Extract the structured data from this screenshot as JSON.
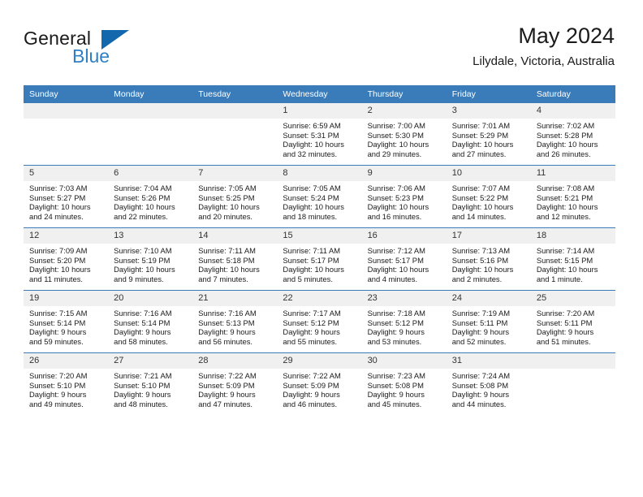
{
  "brand": {
    "word1": "General",
    "word2": "Blue",
    "triangle_color": "#1267ad",
    "blue_color": "#2f7fc4"
  },
  "header": {
    "title": "May 2024",
    "subtitle": "Lilydale, Victoria, Australia",
    "header_bg": "#3a7cba",
    "daynum_bg": "#f0f0f0"
  },
  "weekday_headers": [
    "Sunday",
    "Monday",
    "Tuesday",
    "Wednesday",
    "Thursday",
    "Friday",
    "Saturday"
  ],
  "weeks": [
    [
      {
        "day": "",
        "empty": true,
        "sunrise": "",
        "sunset": "",
        "daylight1": "",
        "daylight2": ""
      },
      {
        "day": "",
        "empty": true,
        "sunrise": "",
        "sunset": "",
        "daylight1": "",
        "daylight2": ""
      },
      {
        "day": "",
        "empty": true,
        "sunrise": "",
        "sunset": "",
        "daylight1": "",
        "daylight2": ""
      },
      {
        "day": "1",
        "empty": false,
        "sunrise": "Sunrise: 6:59 AM",
        "sunset": "Sunset: 5:31 PM",
        "daylight1": "Daylight: 10 hours",
        "daylight2": "and 32 minutes."
      },
      {
        "day": "2",
        "empty": false,
        "sunrise": "Sunrise: 7:00 AM",
        "sunset": "Sunset: 5:30 PM",
        "daylight1": "Daylight: 10 hours",
        "daylight2": "and 29 minutes."
      },
      {
        "day": "3",
        "empty": false,
        "sunrise": "Sunrise: 7:01 AM",
        "sunset": "Sunset: 5:29 PM",
        "daylight1": "Daylight: 10 hours",
        "daylight2": "and 27 minutes."
      },
      {
        "day": "4",
        "empty": false,
        "sunrise": "Sunrise: 7:02 AM",
        "sunset": "Sunset: 5:28 PM",
        "daylight1": "Daylight: 10 hours",
        "daylight2": "and 26 minutes."
      }
    ],
    [
      {
        "day": "5",
        "empty": false,
        "sunrise": "Sunrise: 7:03 AM",
        "sunset": "Sunset: 5:27 PM",
        "daylight1": "Daylight: 10 hours",
        "daylight2": "and 24 minutes."
      },
      {
        "day": "6",
        "empty": false,
        "sunrise": "Sunrise: 7:04 AM",
        "sunset": "Sunset: 5:26 PM",
        "daylight1": "Daylight: 10 hours",
        "daylight2": "and 22 minutes."
      },
      {
        "day": "7",
        "empty": false,
        "sunrise": "Sunrise: 7:05 AM",
        "sunset": "Sunset: 5:25 PM",
        "daylight1": "Daylight: 10 hours",
        "daylight2": "and 20 minutes."
      },
      {
        "day": "8",
        "empty": false,
        "sunrise": "Sunrise: 7:05 AM",
        "sunset": "Sunset: 5:24 PM",
        "daylight1": "Daylight: 10 hours",
        "daylight2": "and 18 minutes."
      },
      {
        "day": "9",
        "empty": false,
        "sunrise": "Sunrise: 7:06 AM",
        "sunset": "Sunset: 5:23 PM",
        "daylight1": "Daylight: 10 hours",
        "daylight2": "and 16 minutes."
      },
      {
        "day": "10",
        "empty": false,
        "sunrise": "Sunrise: 7:07 AM",
        "sunset": "Sunset: 5:22 PM",
        "daylight1": "Daylight: 10 hours",
        "daylight2": "and 14 minutes."
      },
      {
        "day": "11",
        "empty": false,
        "sunrise": "Sunrise: 7:08 AM",
        "sunset": "Sunset: 5:21 PM",
        "daylight1": "Daylight: 10 hours",
        "daylight2": "and 12 minutes."
      }
    ],
    [
      {
        "day": "12",
        "empty": false,
        "sunrise": "Sunrise: 7:09 AM",
        "sunset": "Sunset: 5:20 PM",
        "daylight1": "Daylight: 10 hours",
        "daylight2": "and 11 minutes."
      },
      {
        "day": "13",
        "empty": false,
        "sunrise": "Sunrise: 7:10 AM",
        "sunset": "Sunset: 5:19 PM",
        "daylight1": "Daylight: 10 hours",
        "daylight2": "and 9 minutes."
      },
      {
        "day": "14",
        "empty": false,
        "sunrise": "Sunrise: 7:11 AM",
        "sunset": "Sunset: 5:18 PM",
        "daylight1": "Daylight: 10 hours",
        "daylight2": "and 7 minutes."
      },
      {
        "day": "15",
        "empty": false,
        "sunrise": "Sunrise: 7:11 AM",
        "sunset": "Sunset: 5:17 PM",
        "daylight1": "Daylight: 10 hours",
        "daylight2": "and 5 minutes."
      },
      {
        "day": "16",
        "empty": false,
        "sunrise": "Sunrise: 7:12 AM",
        "sunset": "Sunset: 5:17 PM",
        "daylight1": "Daylight: 10 hours",
        "daylight2": "and 4 minutes."
      },
      {
        "day": "17",
        "empty": false,
        "sunrise": "Sunrise: 7:13 AM",
        "sunset": "Sunset: 5:16 PM",
        "daylight1": "Daylight: 10 hours",
        "daylight2": "and 2 minutes."
      },
      {
        "day": "18",
        "empty": false,
        "sunrise": "Sunrise: 7:14 AM",
        "sunset": "Sunset: 5:15 PM",
        "daylight1": "Daylight: 10 hours",
        "daylight2": "and 1 minute."
      }
    ],
    [
      {
        "day": "19",
        "empty": false,
        "sunrise": "Sunrise: 7:15 AM",
        "sunset": "Sunset: 5:14 PM",
        "daylight1": "Daylight: 9 hours",
        "daylight2": "and 59 minutes."
      },
      {
        "day": "20",
        "empty": false,
        "sunrise": "Sunrise: 7:16 AM",
        "sunset": "Sunset: 5:14 PM",
        "daylight1": "Daylight: 9 hours",
        "daylight2": "and 58 minutes."
      },
      {
        "day": "21",
        "empty": false,
        "sunrise": "Sunrise: 7:16 AM",
        "sunset": "Sunset: 5:13 PM",
        "daylight1": "Daylight: 9 hours",
        "daylight2": "and 56 minutes."
      },
      {
        "day": "22",
        "empty": false,
        "sunrise": "Sunrise: 7:17 AM",
        "sunset": "Sunset: 5:12 PM",
        "daylight1": "Daylight: 9 hours",
        "daylight2": "and 55 minutes."
      },
      {
        "day": "23",
        "empty": false,
        "sunrise": "Sunrise: 7:18 AM",
        "sunset": "Sunset: 5:12 PM",
        "daylight1": "Daylight: 9 hours",
        "daylight2": "and 53 minutes."
      },
      {
        "day": "24",
        "empty": false,
        "sunrise": "Sunrise: 7:19 AM",
        "sunset": "Sunset: 5:11 PM",
        "daylight1": "Daylight: 9 hours",
        "daylight2": "and 52 minutes."
      },
      {
        "day": "25",
        "empty": false,
        "sunrise": "Sunrise: 7:20 AM",
        "sunset": "Sunset: 5:11 PM",
        "daylight1": "Daylight: 9 hours",
        "daylight2": "and 51 minutes."
      }
    ],
    [
      {
        "day": "26",
        "empty": false,
        "sunrise": "Sunrise: 7:20 AM",
        "sunset": "Sunset: 5:10 PM",
        "daylight1": "Daylight: 9 hours",
        "daylight2": "and 49 minutes."
      },
      {
        "day": "27",
        "empty": false,
        "sunrise": "Sunrise: 7:21 AM",
        "sunset": "Sunset: 5:10 PM",
        "daylight1": "Daylight: 9 hours",
        "daylight2": "and 48 minutes."
      },
      {
        "day": "28",
        "empty": false,
        "sunrise": "Sunrise: 7:22 AM",
        "sunset": "Sunset: 5:09 PM",
        "daylight1": "Daylight: 9 hours",
        "daylight2": "and 47 minutes."
      },
      {
        "day": "29",
        "empty": false,
        "sunrise": "Sunrise: 7:22 AM",
        "sunset": "Sunset: 5:09 PM",
        "daylight1": "Daylight: 9 hours",
        "daylight2": "and 46 minutes."
      },
      {
        "day": "30",
        "empty": false,
        "sunrise": "Sunrise: 7:23 AM",
        "sunset": "Sunset: 5:08 PM",
        "daylight1": "Daylight: 9 hours",
        "daylight2": "and 45 minutes."
      },
      {
        "day": "31",
        "empty": false,
        "sunrise": "Sunrise: 7:24 AM",
        "sunset": "Sunset: 5:08 PM",
        "daylight1": "Daylight: 9 hours",
        "daylight2": "and 44 minutes."
      },
      {
        "day": "",
        "empty": true,
        "sunrise": "",
        "sunset": "",
        "daylight1": "",
        "daylight2": ""
      }
    ]
  ]
}
